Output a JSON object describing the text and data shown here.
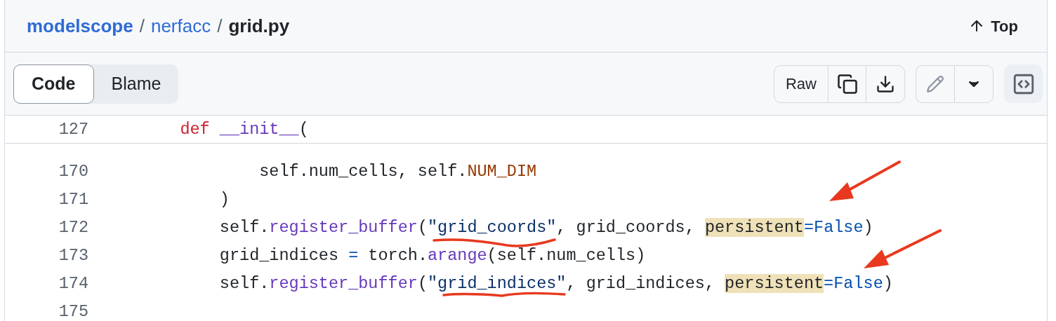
{
  "breadcrumb": [
    {
      "text": "modelscope",
      "kind": "repo"
    },
    {
      "text": "/",
      "kind": "separator"
    },
    {
      "text": "nerfacc",
      "kind": "folder"
    },
    {
      "text": "/",
      "kind": "separator"
    },
    {
      "text": "grid.py",
      "kind": "file"
    }
  ],
  "top_link": "Top",
  "tabs": [
    {
      "label": "Code",
      "selected": true
    },
    {
      "label": "Blame",
      "selected": false
    }
  ],
  "raw_button": "Raw",
  "sticky_line": {
    "number": "127",
    "tokens": [
      {
        "t": "    def",
        "kind": "keyword"
      },
      {
        "t": " __init__",
        "kind": "function"
      },
      {
        "t": "(",
        "kind": "plain"
      }
    ]
  },
  "lines": [
    {
      "number": "170",
      "tokens": [
        {
          "t": "            self.num_cells, self.",
          "kind": "plain"
        },
        {
          "t": "NUM_DIM",
          "kind": "constant"
        }
      ]
    },
    {
      "number": "171",
      "tokens": [
        {
          "t": "        )",
          "kind": "plain"
        }
      ]
    },
    {
      "number": "172",
      "tokens": [
        {
          "t": "        self.",
          "kind": "plain"
        },
        {
          "t": "register_buffer",
          "kind": "function"
        },
        {
          "t": "(",
          "kind": "plain"
        },
        {
          "t": "\"grid_coords\"",
          "kind": "string"
        },
        {
          "t": ", grid_coords, ",
          "kind": "plain"
        },
        {
          "t": "persistent",
          "kind": "highlighted"
        },
        {
          "t": "=",
          "kind": "boolean"
        },
        {
          "t": "False",
          "kind": "boolean"
        },
        {
          "t": ")",
          "kind": "plain"
        }
      ]
    },
    {
      "number": "173",
      "tokens": [
        {
          "t": "        grid_indices ",
          "kind": "plain"
        },
        {
          "t": "=",
          "kind": "boolean"
        },
        {
          "t": " torch.",
          "kind": "plain"
        },
        {
          "t": "arange",
          "kind": "function"
        },
        {
          "t": "(self.num_cells)",
          "kind": "plain"
        }
      ]
    },
    {
      "number": "174",
      "tokens": [
        {
          "t": "        self.",
          "kind": "plain"
        },
        {
          "t": "register_buffer",
          "kind": "function"
        },
        {
          "t": "(",
          "kind": "plain"
        },
        {
          "t": "\"grid_indices\"",
          "kind": "string"
        },
        {
          "t": ", grid_indices, ",
          "kind": "plain"
        },
        {
          "t": "persistent",
          "kind": "highlighted"
        },
        {
          "t": "=",
          "kind": "boolean"
        },
        {
          "t": "False",
          "kind": "boolean"
        },
        {
          "t": ")",
          "kind": "plain"
        }
      ]
    },
    {
      "number": "175"
    }
  ]
}
